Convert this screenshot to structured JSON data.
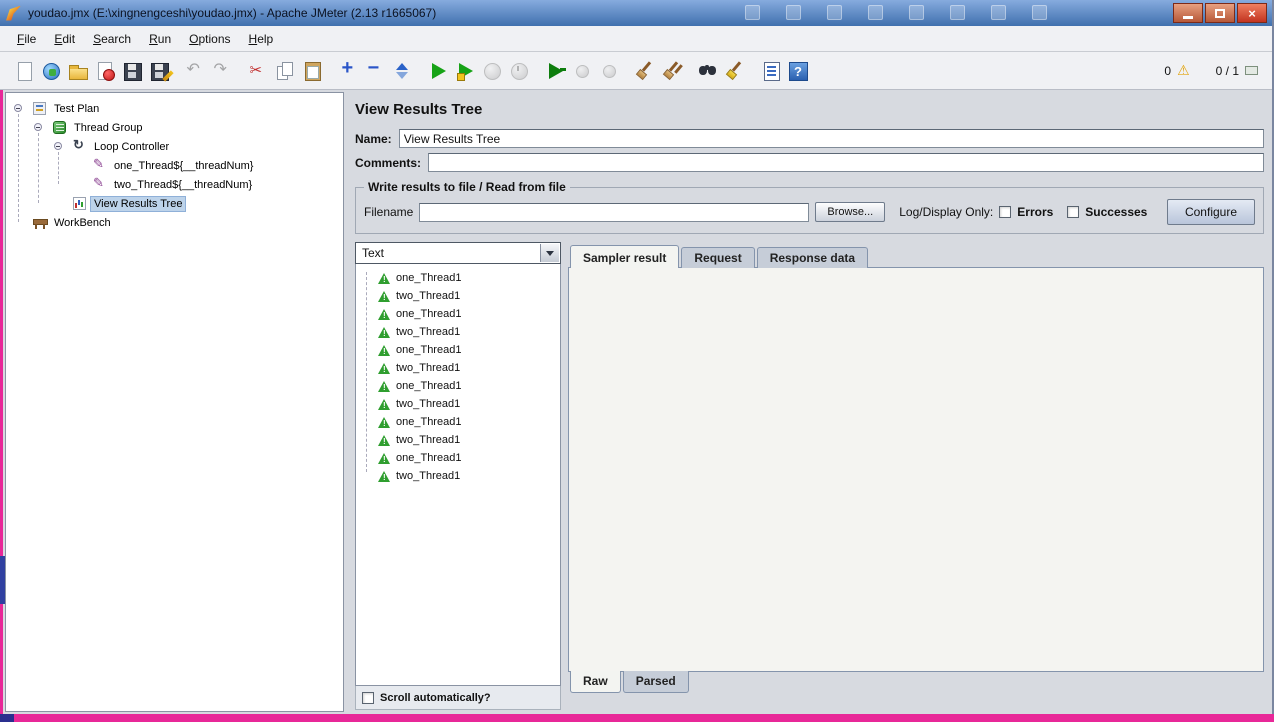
{
  "window": {
    "title": "youdao.jmx (E:\\xingnengceshi\\youdao.jmx) - Apache JMeter (2.13 r1665067)"
  },
  "menu": [
    {
      "label": "File"
    },
    {
      "label": "Edit"
    },
    {
      "label": "Search"
    },
    {
      "label": "Run"
    },
    {
      "label": "Options"
    },
    {
      "label": "Help"
    }
  ],
  "toolbar": {
    "icons": [
      "new",
      "templates",
      "open",
      "close",
      "save",
      "save-as",
      "undo",
      "redo",
      "cut",
      "copy",
      "paste",
      "expand-all",
      "collapse-all",
      "toggle",
      "start",
      "start-no-timers",
      "stop",
      "shutdown",
      "remote-start-all",
      "remote-stop-all",
      "remote-shutdown-all",
      "clear",
      "clear-all",
      "search",
      "search-reset",
      "function-helper",
      "help"
    ],
    "warning_count": "0",
    "thread_count": "0 / 1"
  },
  "tree": {
    "items": [
      {
        "label": "Test Plan"
      },
      {
        "label": "Thread Group"
      },
      {
        "label": "Loop Controller"
      },
      {
        "label": "one_Thread${__threadNum}"
      },
      {
        "label": "two_Thread${__threadNum}"
      },
      {
        "label": "View Results Tree",
        "selected": true
      },
      {
        "label": "WorkBench"
      }
    ]
  },
  "main": {
    "title": "View Results Tree",
    "name_label": "Name:",
    "name_value": "View Results Tree",
    "comments_label": "Comments:",
    "comments_value": "",
    "file_group": {
      "title": "Write results to file / Read from file",
      "filename_label": "Filename",
      "filename_value": "",
      "browse_label": "Browse...",
      "log_display_label": "Log/Display Only:",
      "errors_label": "Errors",
      "successes_label": "Successes",
      "configure_label": "Configure"
    },
    "tabs": [
      "Sampler result",
      "Request",
      "Response data"
    ],
    "active_tab": "Sampler result",
    "bottom_tabs": [
      "Raw",
      "Parsed"
    ],
    "active_bottom_tab": "Raw"
  },
  "results": {
    "view_mode": "Text",
    "scroll_label": "Scroll automatically?",
    "items": [
      "one_Thread1",
      "two_Thread1",
      "one_Thread1",
      "two_Thread1",
      "one_Thread1",
      "two_Thread1",
      "one_Thread1",
      "two_Thread1",
      "one_Thread1",
      "two_Thread1",
      "one_Thread1",
      "two_Thread1"
    ]
  }
}
